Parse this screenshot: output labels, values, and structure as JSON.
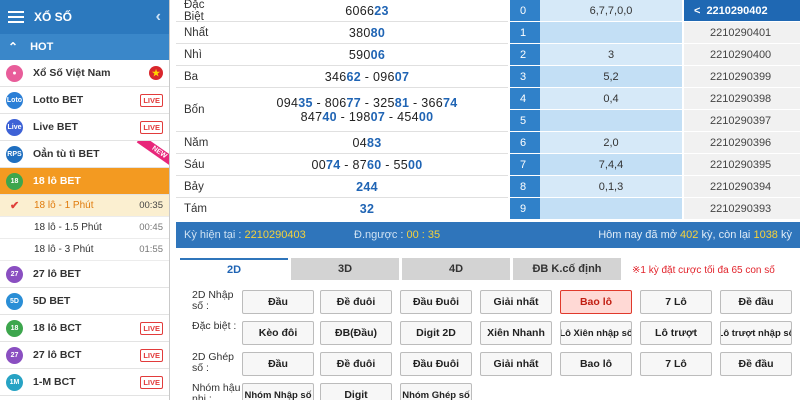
{
  "sidebar": {
    "title": "XỔ SỐ",
    "hot_label": "HOT",
    "items": [
      {
        "label": "Xổ Số Việt Nam",
        "icon_text": "",
        "badge": "",
        "star": true
      },
      {
        "label": "Lotto BET",
        "icon_text": "Loto",
        "badge": "LIVE"
      },
      {
        "label": "Live BET",
        "icon_text": "Live",
        "badge": "LIVE"
      },
      {
        "label": "Oẳn tù tì BET",
        "icon_text": "RPS",
        "badge": "",
        "ribbon": "NEW"
      },
      {
        "label": "18 lô BET",
        "icon_text": "18",
        "badge": ""
      }
    ],
    "subitems": [
      {
        "label": "18 lô - 1 Phút",
        "time": "00:35"
      },
      {
        "label": "18 lô - 1.5 Phút",
        "time": "00:45"
      },
      {
        "label": "18 lô - 3 Phút",
        "time": "01:55"
      }
    ],
    "items2": [
      {
        "label": "27 lô BET",
        "icon_text": "27",
        "badge": ""
      },
      {
        "label": "5D BET",
        "icon_text": "5D",
        "badge": ""
      },
      {
        "label": "18 lô BCT",
        "icon_text": "18",
        "badge": "LIVE"
      },
      {
        "label": "27 lô BCT",
        "icon_text": "27",
        "badge": "LIVE"
      },
      {
        "label": "1-M BCT",
        "icon_text": "1M",
        "badge": "LIVE"
      }
    ]
  },
  "results": [
    {
      "name": "Đặc Biệt",
      "lines": [
        {
          "pre": "6066",
          "hl": "23"
        }
      ]
    },
    {
      "name": "Nhất",
      "lines": [
        {
          "pre": "380",
          "hl": "80"
        }
      ]
    },
    {
      "name": "Nhì",
      "lines": [
        {
          "pre": "590",
          "hl": "06"
        }
      ]
    },
    {
      "name": "Ba",
      "lines": [
        {
          "pre": "346",
          "hl": "62",
          "sep": " - ",
          "pre2": "096",
          "hl2": "07"
        }
      ]
    },
    {
      "name": "Bốn",
      "lines": [
        {
          "text_parts": [
            "094",
            "35",
            " - 806",
            "77",
            " - 325",
            "81",
            " - 366",
            "74"
          ]
        },
        {
          "text_parts": [
            "847",
            "40",
            " - 198",
            "07",
            " - 454",
            "00"
          ]
        }
      ]
    },
    {
      "name": "Năm",
      "lines": [
        {
          "pre": "04",
          "hl": "83"
        }
      ]
    },
    {
      "name": "Sáu",
      "lines": [
        {
          "text_parts": [
            "00",
            "74",
            " - 87",
            "60",
            " - 55",
            "00"
          ]
        }
      ]
    },
    {
      "name": "Bảy",
      "lines": [
        {
          "pre": "",
          "hl": "244"
        }
      ]
    },
    {
      "name": "Tám",
      "lines": [
        {
          "pre": "",
          "hl": "32"
        }
      ]
    }
  ],
  "head_tail": [
    {
      "i": "0",
      "v": "6,7,7,0,0"
    },
    {
      "i": "1",
      "v": ""
    },
    {
      "i": "2",
      "v": "3"
    },
    {
      "i": "3",
      "v": "5,2"
    },
    {
      "i": "4",
      "v": "0,4"
    },
    {
      "i": "5",
      "v": ""
    },
    {
      "i": "6",
      "v": "2,0"
    },
    {
      "i": "7",
      "v": "7,4,4"
    },
    {
      "i": "8",
      "v": "0,1,3"
    },
    {
      "i": "9",
      "v": ""
    }
  ],
  "periods": {
    "current": "2210290402",
    "list": [
      "2210290401",
      "2210290400",
      "2210290399",
      "2210290398",
      "2210290397",
      "2210290396",
      "2210290395",
      "2210290394",
      "2210290393"
    ]
  },
  "status": {
    "period_label": "Kỳ hiện tại :",
    "period_value": "2210290403",
    "countdown_label": "Đ.ngược :",
    "countdown_value": "00 : 35",
    "today_prefix": "Hôm nay đã mở",
    "today_count": "402",
    "today_mid": "kỳ, còn lại",
    "today_left": "1038",
    "today_suffix": "kỳ"
  },
  "tabs": [
    "2D",
    "3D",
    "4D",
    "ĐB K.cố định"
  ],
  "tab_note": "※1 kỳ đặt cược tối đa 65 con số",
  "bet_rows": [
    {
      "label": "2D Nhập số :",
      "buttons": [
        "Đầu",
        "Đề đuôi",
        "Đầu Đuôi",
        "Giải nhất",
        "Bao lô",
        "7 Lô",
        "Đề đầu"
      ]
    },
    {
      "label": "Đặc biệt :",
      "buttons": [
        "Kèo đôi",
        "ĐB(Đầu)",
        "Digit 2D",
        "Xiên Nhanh",
        "Lô Xiên nhập số",
        "Lô trượt",
        "Lô trượt nhập số"
      ]
    },
    {
      "label": "2D Ghép số :",
      "buttons": [
        "Đầu",
        "Đề đuôi",
        "Đầu Đuôi",
        "Giải nhất",
        "Bao lô",
        "7 Lô",
        "Đề đầu"
      ]
    },
    {
      "label": "Nhóm hậu nhị :",
      "buttons": [
        "Nhóm Nhập số",
        "Digit",
        "Nhóm Ghép số"
      ]
    }
  ],
  "selected_button": "Bao lô",
  "colors": {
    "primary": "#2c79be",
    "accent": "#f39a21",
    "highlight": "#1f64b4",
    "warning": "#e2232b"
  }
}
